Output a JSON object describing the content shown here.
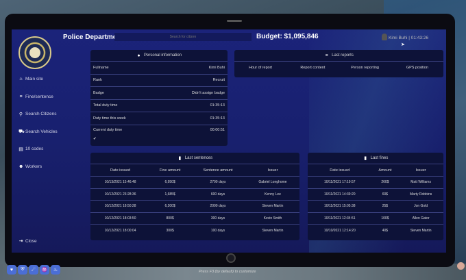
{
  "header": {
    "title": "Police Department",
    "search_placeholder": "Search for citizen",
    "budget": "Budget: $1,095,846",
    "user": "Kimi Buhi | 01:43:26"
  },
  "sidebar": {
    "items": [
      {
        "label": "Main site",
        "icon": "home-icon"
      },
      {
        "label": "Fine/sentence",
        "icon": "list-icon"
      },
      {
        "label": "Search Citizens",
        "icon": "search-icon"
      },
      {
        "label": "Search Vehicles",
        "icon": "car-icon"
      },
      {
        "label": "10 codes",
        "icon": "clipboard-icon"
      },
      {
        "label": "Workers",
        "icon": "users-icon"
      }
    ],
    "close_label": "Close"
  },
  "personal": {
    "title": "Personal information",
    "rows": [
      {
        "label": "Fullname",
        "value": "Kimi Buhi"
      },
      {
        "label": "Rank",
        "value": "Recruit"
      },
      {
        "label": "Badge",
        "value": "Didn't assign badge"
      },
      {
        "label": "Total duty time",
        "value": "01:35:13"
      },
      {
        "label": "Duty time this week",
        "value": "01:35:13"
      }
    ],
    "current": {
      "label": "Current duty time",
      "value": "00:00:51",
      "check": "✔"
    }
  },
  "reports": {
    "title": "Last reports",
    "columns": [
      "Hour of report",
      "Report content",
      "Person reporting",
      "GPS position"
    ]
  },
  "sentences": {
    "title": "Last sentences",
    "columns": [
      "Date issued",
      "Fine amount",
      "Sentence amount",
      "Issuer"
    ],
    "rows": [
      [
        "10/13/2021 15:46:48",
        "6,950$",
        "2700 days",
        "Gabriel Longhome"
      ],
      [
        "10/12/2021 23:28:36",
        "1,685$",
        "600 days",
        "Kenny Lee"
      ],
      [
        "10/12/2021 18:50:28",
        "6,200$",
        "2000 days",
        "Steven Martin"
      ],
      [
        "10/12/2021 18:03:50",
        "800$",
        "300 days",
        "Kevin Smith"
      ],
      [
        "10/12/2021 18:00:04",
        "300$",
        "100 days",
        "Steven Martin"
      ]
    ]
  },
  "fines": {
    "title": "Last fines",
    "columns": [
      "Date issued",
      "Amount",
      "Issuer"
    ],
    "rows": [
      [
        "10/11/2021 17:19:57",
        "260$",
        "Matt Williams"
      ],
      [
        "10/11/2021 14:39:20",
        "60$",
        "Marty Robbins"
      ],
      [
        "10/11/2021 15:05:38",
        "25$",
        "Jon Gold"
      ],
      [
        "10/11/2021 12:34:51",
        "100$",
        "Allen Gator"
      ],
      [
        "10/10/2021 12:14:20",
        "40$",
        "Steven Martin"
      ]
    ]
  },
  "footer": {
    "hint": "Press F3 (by default) to customize"
  }
}
